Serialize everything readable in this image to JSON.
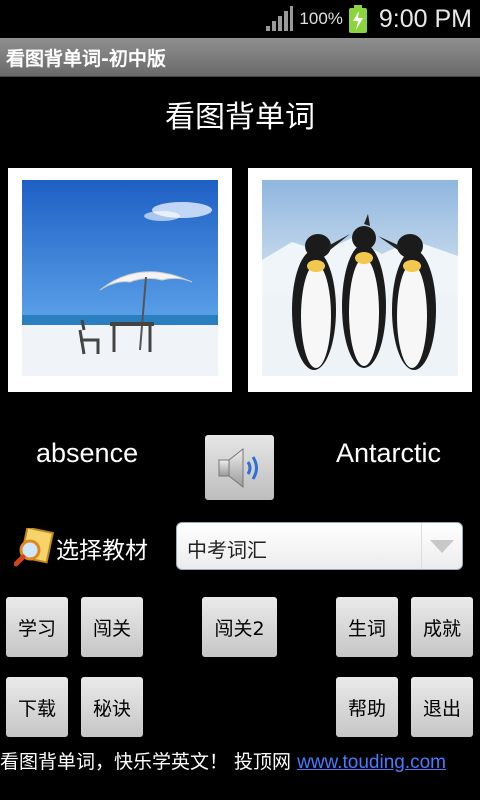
{
  "status_bar": {
    "battery_percent": "100%",
    "time": "9:00 PM",
    "icons": [
      "signal-icon",
      "battery-charging-icon"
    ]
  },
  "window": {
    "title": "看图背单词-初中版"
  },
  "header": {
    "title": "看图背单词"
  },
  "cards": [
    {
      "word": "absence",
      "image": "beach-umbrella-photo"
    },
    {
      "word": "Antarctic",
      "image": "penguins-photo"
    }
  ],
  "audio": {
    "icon": "speaker-icon"
  },
  "textbook": {
    "label": "选择教材",
    "selected": "中考词汇",
    "icon": "magnifier-icon"
  },
  "buttons": {
    "study": "学习",
    "level": "闯关",
    "level2": "闯关2",
    "new_words": "生词",
    "achievements": "成就",
    "download": "下载",
    "tips": "秘诀",
    "help": "帮助",
    "exit": "退出"
  },
  "footer": {
    "text": "看图背单词，快乐学英文！ 投顶网 ",
    "link": "www.touding.com"
  },
  "colors": {
    "background": "#000000",
    "titlebar": "#7d7d7d",
    "link": "#4b7cff"
  }
}
